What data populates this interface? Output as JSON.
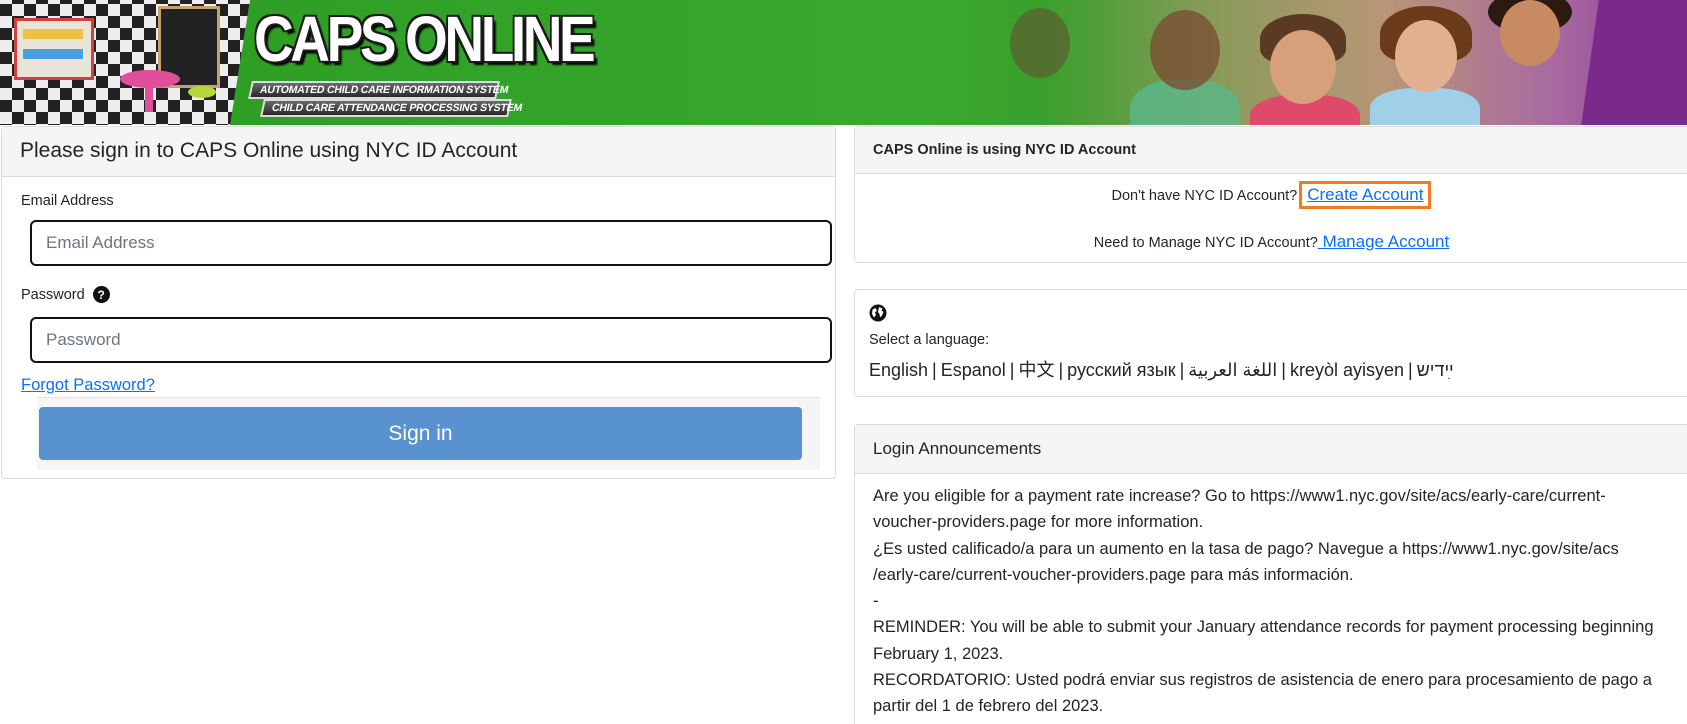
{
  "banner": {
    "logo_title": "CAPS ONLINE",
    "logo_subtitle_1": "AUTOMATED CHILD CARE INFORMATION SYSTEM",
    "logo_subtitle_2": "CHILD CARE ATTENDANCE PROCESSING SYSTEM"
  },
  "login": {
    "header": "Please sign in to CAPS Online using NYC ID Account",
    "email_label": "Email Address",
    "email_placeholder": "Email Address",
    "email_value": "",
    "password_label": "Password",
    "password_help_icon": "question-circle-icon",
    "password_placeholder": "Password",
    "password_value": "",
    "forgot_password": "Forgot Password?",
    "sign_in": "Sign in"
  },
  "nyc_id": {
    "header": "CAPS Online is using NYC ID Account",
    "create_prompt": "Don't have NYC ID Account?",
    "create_link": "Create Account",
    "manage_prompt": "Need to Manage NYC ID Account?",
    "manage_link": " Manage Account"
  },
  "language": {
    "icon": "globe-icon",
    "label": "Select a language:",
    "options": [
      "English",
      "Espanol",
      "中文",
      "русский язык",
      "اللغة العربية",
      "kreyòl ayisyen",
      "ײִדיש"
    ],
    "separator": "|"
  },
  "announcements": {
    "header": "Login Announcements",
    "lines": [
      "Are you eligible for a payment rate increase? Go to https://www1.nyc.gov/site/acs/early-care/current-voucher-providers.page for more information.",
      "¿Es usted calificado/a para un aumento en la tasa de pago? Navegue a https://www1.nyc.gov/site/acs /early-care/current-voucher-providers.page para más información.",
      "-",
      "REMINDER: You will be able to submit your January attendance records for payment processing beginning February 1, 2023.",
      "RECORDATORIO: Usted podrá enviar sus registros de asistencia de enero para procesamiento de pago a partir del 1 de febrero del 2023."
    ]
  },
  "colors": {
    "banner_green": "#35a52a",
    "sign_in_button": "#5892cf",
    "link": "#0d6efd",
    "highlight_border": "#f07d1a"
  }
}
